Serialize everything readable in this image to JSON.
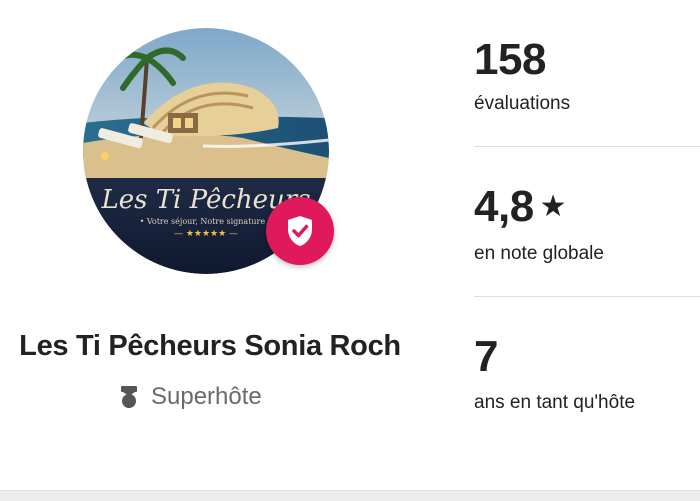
{
  "host": {
    "avatar_text": {
      "name": "Les Ti Pêcheurs",
      "tagline": "• Votre séjour, Notre signature •",
      "stars": "— ★★★★★ —"
    },
    "name": "Les Ti Pêcheurs Sonia Roch",
    "superhost_label": "Superhôte"
  },
  "stats": {
    "reviews": {
      "value": "158",
      "label": "évaluations"
    },
    "rating": {
      "value": "4,8",
      "star": "★",
      "label": "en note globale"
    },
    "years": {
      "value": "7",
      "label": "ans en tant qu'hôte"
    }
  },
  "colors": {
    "badge": "#E0195C",
    "text": "#222222",
    "muted": "#6a6a6a"
  },
  "icons": [
    "verified-shield-icon",
    "superhost-medal-icon",
    "star-icon"
  ]
}
